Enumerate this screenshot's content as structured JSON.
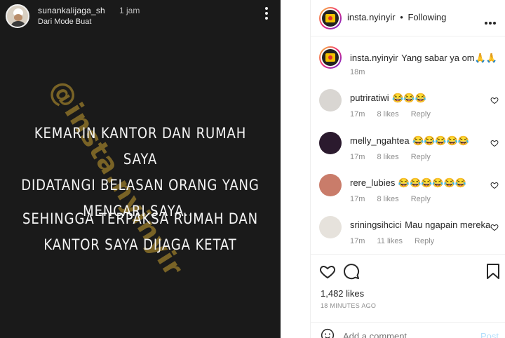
{
  "story": {
    "username": "sunankalijaga_sh",
    "time": "1 jam",
    "subtitle": "Dari Mode Buat",
    "text_line1": "KEMARIN KANTOR DAN RUMAH SAYA",
    "text_line2": "DIDATANGI BELASAN ORANG YANG",
    "text_line3": "MENCARI SAYA...",
    "text_line4": "SEHINGGA TERPAKSA RUMAH DAN",
    "text_line5": "KANTOR SAYA DIJAGA KETAT",
    "watermark": "@insta.nyinyir"
  },
  "header": {
    "username": "insta.nyinyir",
    "separator": "•",
    "follow_status": "Following"
  },
  "caption": {
    "username": "insta.nyinyir",
    "text": "Yang sabar ya om🙏🙏",
    "time": "18m"
  },
  "comments": [
    {
      "username": "putriratiwi",
      "text": "😂😂😂",
      "time": "17m",
      "likes": "8 likes",
      "reply": "Reply"
    },
    {
      "username": "melly_ngahtea",
      "text": "😂😂😂😂😂",
      "time": "17m",
      "likes": "8 likes",
      "reply": "Reply"
    },
    {
      "username": "rere_lubies",
      "text": "😂😂😂😂😂😂",
      "time": "17m",
      "likes": "8 likes",
      "reply": "Reply"
    },
    {
      "username": "sriningsihcici",
      "text": "Mau ngapain mereka",
      "time": "17m",
      "likes": "11 likes",
      "reply": "Reply"
    }
  ],
  "post": {
    "likes": "1,482 likes",
    "time_ago": "18 MINUTES AGO",
    "add_comment_placeholder": "Add a comment...",
    "post_button": "Post"
  },
  "icons": {
    "heart": "heart-icon",
    "comment": "comment-icon",
    "bookmark": "bookmark-icon",
    "emoji": "emoji-icon",
    "more": "more-icon"
  },
  "colors": {
    "story_bg": "#1a1a1a",
    "text_primary": "#262626",
    "text_secondary": "#8e8e8e",
    "post_button": "#b2dffc"
  }
}
